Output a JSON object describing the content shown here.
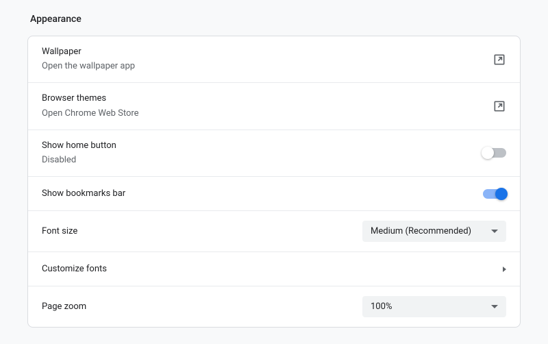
{
  "section": {
    "title": "Appearance"
  },
  "rows": {
    "wallpaper": {
      "title": "Wallpaper",
      "subtitle": "Open the wallpaper app"
    },
    "themes": {
      "title": "Browser themes",
      "subtitle": "Open Chrome Web Store"
    },
    "home_button": {
      "title": "Show home button",
      "subtitle": "Disabled",
      "enabled": false
    },
    "bookmarks_bar": {
      "title": "Show bookmarks bar",
      "enabled": true
    },
    "font_size": {
      "title": "Font size",
      "value": "Medium (Recommended)"
    },
    "customize_fonts": {
      "title": "Customize fonts"
    },
    "page_zoom": {
      "title": "Page zoom",
      "value": "100%"
    }
  }
}
